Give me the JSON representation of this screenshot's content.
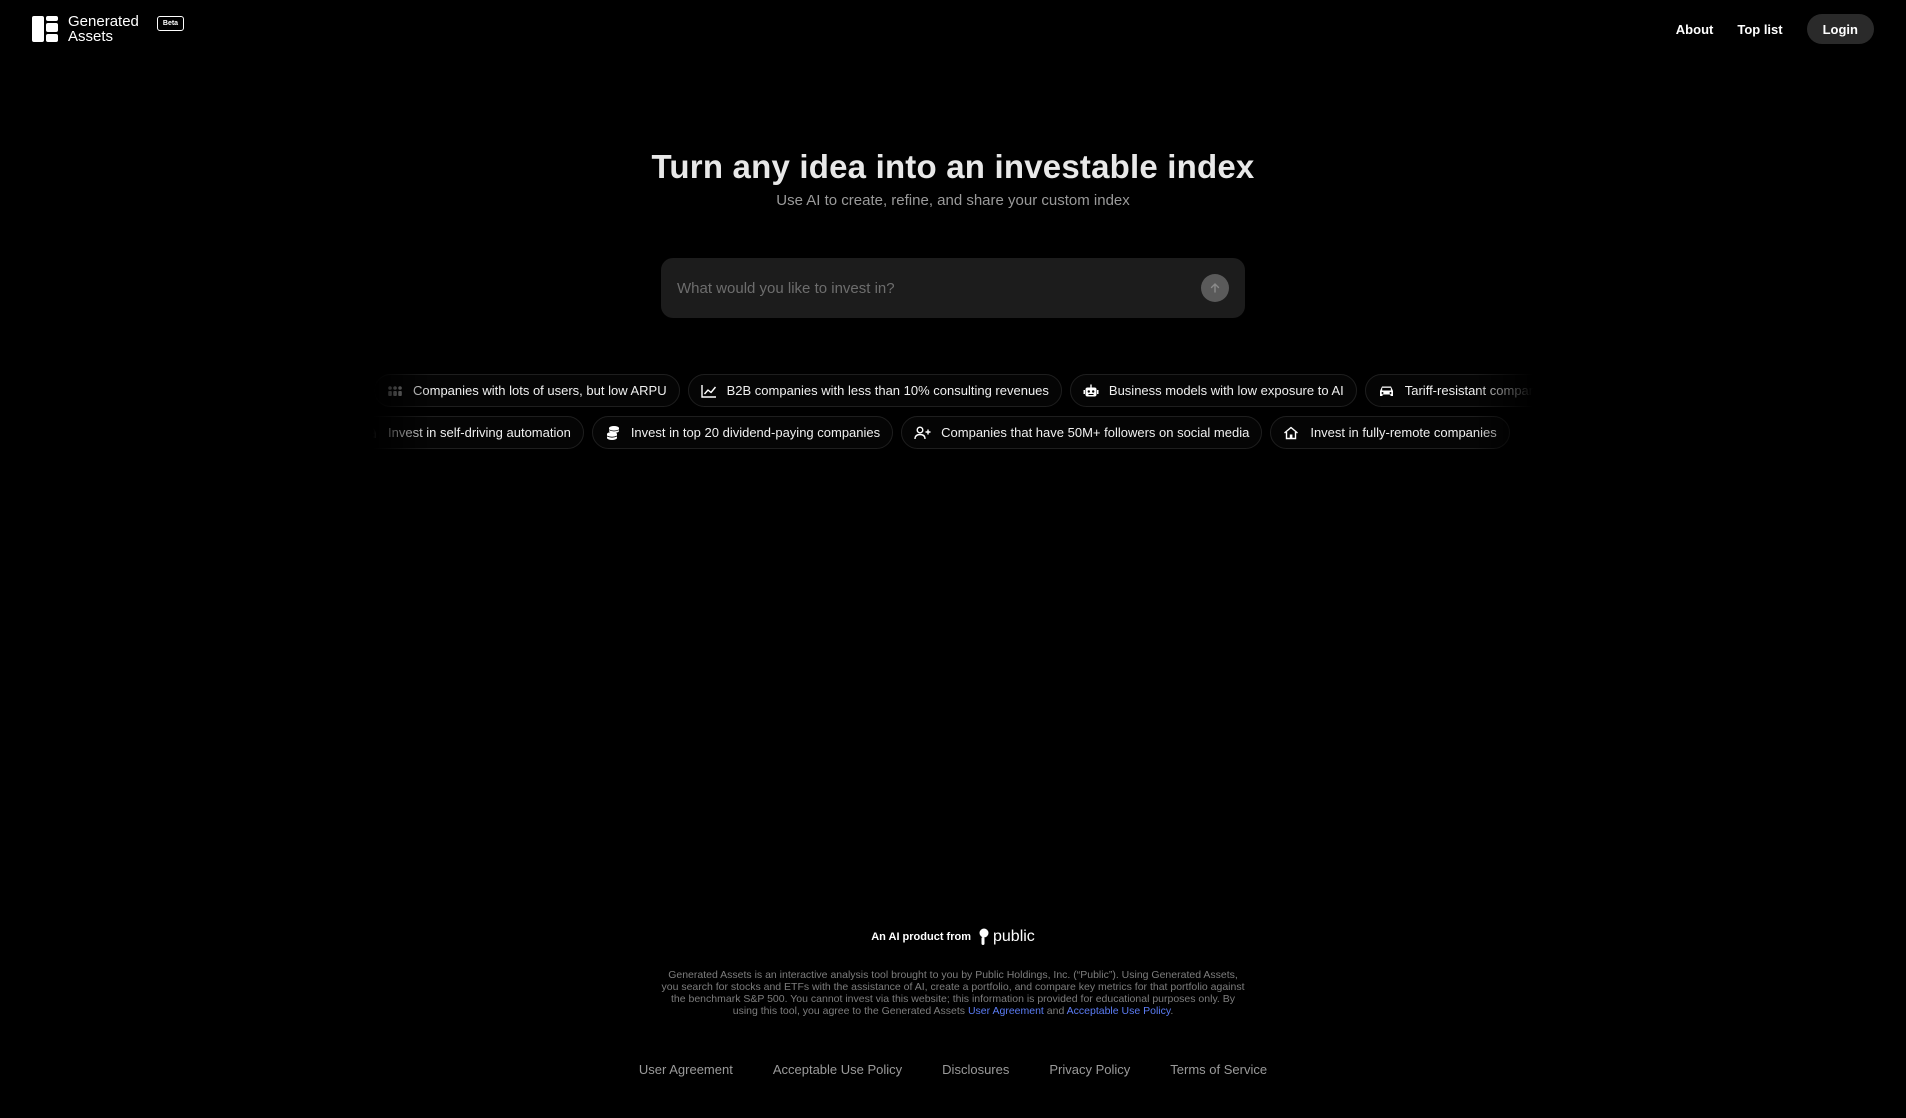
{
  "header": {
    "brand_line1": "Generated",
    "brand_line2": "Assets",
    "beta_badge": "Beta",
    "nav": {
      "about": "About",
      "top_list": "Top list",
      "login": "Login"
    }
  },
  "hero": {
    "title": "Turn any idea into an investable index",
    "subtitle": "Use AI to create, refine, and share your custom index"
  },
  "search": {
    "placeholder": "What would you like to invest in?",
    "submit_icon": "arrow-up-icon"
  },
  "suggestions_row1": [
    {
      "label": "Companies with lots of users, but low ARPU",
      "icon": "users-icon"
    },
    {
      "label": "B2B companies with less than 10% consulting revenues",
      "icon": "chart-line-icon"
    },
    {
      "label": "Business models with low exposure to AI",
      "icon": "robot-icon"
    },
    {
      "label": "Tariff-resistant companies",
      "icon": "car-icon"
    }
  ],
  "suggestions_row2": [
    {
      "label": "Invest in self-driving automation",
      "icon": "car-icon"
    },
    {
      "label": "Invest in top 20 dividend-paying companies",
      "icon": "coins-icon"
    },
    {
      "label": "Companies that have 50M+ followers on social media",
      "icon": "user-plus-icon"
    },
    {
      "label": "Invest in fully-remote companies",
      "icon": "home-icon"
    }
  ],
  "footer": {
    "product_from": "An AI product from",
    "public_brand": "public",
    "disclaimer_text": "Generated Assets is an interactive analysis tool brought to you by Public Holdings, Inc. (“Public”). Using Generated Assets, you search for stocks and ETFs with the assistance of AI, create a portfolio, and compare key metrics for that portfolio against the benchmark S&P 500. You cannot invest via this website; this information is provided for educational purposes only. By using this tool, you agree to the Generated Assets",
    "disclaimer_link1": "User Agreement",
    "disclaimer_and": "and",
    "disclaimer_link2": "Acceptable Use Policy",
    "disclaimer_end": ".",
    "links": [
      "User Agreement",
      "Acceptable Use Policy",
      "Disclosures",
      "Privacy Policy",
      "Terms of Service"
    ]
  },
  "colors": {
    "background": "#000000",
    "chip_border": "#1e1e1e",
    "search_bg": "#1c1c1c",
    "link_blue": "#5b7cf5",
    "login_bg": "#2a2a2a"
  }
}
